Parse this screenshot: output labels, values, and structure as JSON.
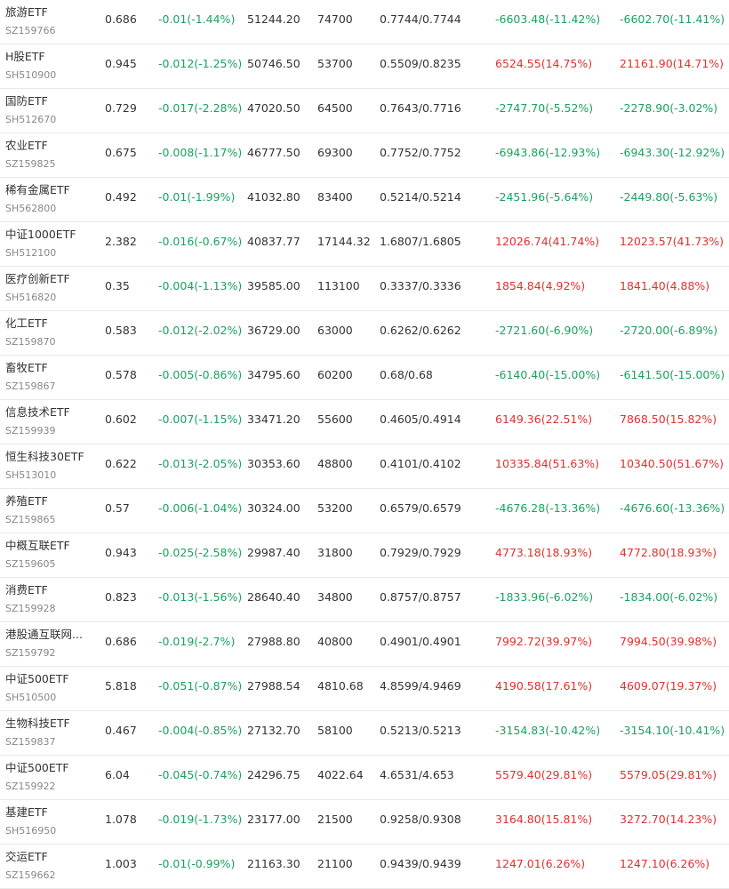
{
  "colors": {
    "up": "#e0312c",
    "down": "#1aa260",
    "text": "#333333",
    "subtext": "#888888"
  },
  "rows": [
    {
      "name": "旅游ETF",
      "code": "SZ159766",
      "price": "0.686",
      "change": "-0.01(-1.44%)",
      "value": "51244.20",
      "shares": "74700",
      "cost": "0.7744/0.7744",
      "pl1": "-6603.48(-11.42%)",
      "pl2": "-6602.70(-11.41%)",
      "pl1_dir": "down",
      "pl2_dir": "down"
    },
    {
      "name": "H股ETF",
      "code": "SH510900",
      "price": "0.945",
      "change": "-0.012(-1.25%)",
      "value": "50746.50",
      "shares": "53700",
      "cost": "0.5509/0.8235",
      "pl1": "6524.55(14.75%)",
      "pl2": "21161.90(14.71%)",
      "pl1_dir": "up",
      "pl2_dir": "up"
    },
    {
      "name": "国防ETF",
      "code": "SH512670",
      "price": "0.729",
      "change": "-0.017(-2.28%)",
      "value": "47020.50",
      "shares": "64500",
      "cost": "0.7643/0.7716",
      "pl1": "-2747.70(-5.52%)",
      "pl2": "-2278.90(-3.02%)",
      "pl1_dir": "down",
      "pl2_dir": "down"
    },
    {
      "name": "农业ETF",
      "code": "SZ159825",
      "price": "0.675",
      "change": "-0.008(-1.17%)",
      "value": "46777.50",
      "shares": "69300",
      "cost": "0.7752/0.7752",
      "pl1": "-6943.86(-12.93%)",
      "pl2": "-6943.30(-12.92%)",
      "pl1_dir": "down",
      "pl2_dir": "down"
    },
    {
      "name": "稀有金属ETF",
      "code": "SH562800",
      "price": "0.492",
      "change": "-0.01(-1.99%)",
      "value": "41032.80",
      "shares": "83400",
      "cost": "0.5214/0.5214",
      "pl1": "-2451.96(-5.64%)",
      "pl2": "-2449.80(-5.63%)",
      "pl1_dir": "down",
      "pl2_dir": "down"
    },
    {
      "name": "中证1000ETF",
      "code": "SH512100",
      "price": "2.382",
      "change": "-0.016(-0.67%)",
      "value": "40837.77",
      "shares": "17144.32",
      "cost": "1.6807/1.6805",
      "pl1": "12026.74(41.74%)",
      "pl2": "12023.57(41.73%)",
      "pl1_dir": "up",
      "pl2_dir": "up"
    },
    {
      "name": "医疗创新ETF",
      "code": "SH516820",
      "price": "0.35",
      "change": "-0.004(-1.13%)",
      "value": "39585.00",
      "shares": "113100",
      "cost": "0.3337/0.3336",
      "pl1": "1854.84(4.92%)",
      "pl2": "1841.40(4.88%)",
      "pl1_dir": "up",
      "pl2_dir": "up"
    },
    {
      "name": "化工ETF",
      "code": "SZ159870",
      "price": "0.583",
      "change": "-0.012(-2.02%)",
      "value": "36729.00",
      "shares": "63000",
      "cost": "0.6262/0.6262",
      "pl1": "-2721.60(-6.90%)",
      "pl2": "-2720.00(-6.89%)",
      "pl1_dir": "down",
      "pl2_dir": "down"
    },
    {
      "name": "畜牧ETF",
      "code": "SZ159867",
      "price": "0.578",
      "change": "-0.005(-0.86%)",
      "value": "34795.60",
      "shares": "60200",
      "cost": "0.68/0.68",
      "pl1": "-6140.40(-15.00%)",
      "pl2": "-6141.50(-15.00%)",
      "pl1_dir": "down",
      "pl2_dir": "down"
    },
    {
      "name": "信息技术ETF",
      "code": "SZ159939",
      "price": "0.602",
      "change": "-0.007(-1.15%)",
      "value": "33471.20",
      "shares": "55600",
      "cost": "0.4605/0.4914",
      "pl1": "6149.36(22.51%)",
      "pl2": "7868.50(15.82%)",
      "pl1_dir": "up",
      "pl2_dir": "up"
    },
    {
      "name": "恒生科技30ETF",
      "code": "SH513010",
      "price": "0.622",
      "change": "-0.013(-2.05%)",
      "value": "30353.60",
      "shares": "48800",
      "cost": "0.4101/0.4102",
      "pl1": "10335.84(51.63%)",
      "pl2": "10340.50(51.67%)",
      "pl1_dir": "up",
      "pl2_dir": "up"
    },
    {
      "name": "养殖ETF",
      "code": "SZ159865",
      "price": "0.57",
      "change": "-0.006(-1.04%)",
      "value": "30324.00",
      "shares": "53200",
      "cost": "0.6579/0.6579",
      "pl1": "-4676.28(-13.36%)",
      "pl2": "-4676.60(-13.36%)",
      "pl1_dir": "down",
      "pl2_dir": "down"
    },
    {
      "name": "中概互联ETF",
      "code": "SZ159605",
      "price": "0.943",
      "change": "-0.025(-2.58%)",
      "value": "29987.40",
      "shares": "31800",
      "cost": "0.7929/0.7929",
      "pl1": "4773.18(18.93%)",
      "pl2": "4772.80(18.93%)",
      "pl1_dir": "up",
      "pl2_dir": "up"
    },
    {
      "name": "消费ETF",
      "code": "SZ159928",
      "price": "0.823",
      "change": "-0.013(-1.56%)",
      "value": "28640.40",
      "shares": "34800",
      "cost": "0.8757/0.8757",
      "pl1": "-1833.96(-6.02%)",
      "pl2": "-1834.00(-6.02%)",
      "pl1_dir": "down",
      "pl2_dir": "down"
    },
    {
      "name": "港股通互联网...",
      "code": "SZ159792",
      "price": "0.686",
      "change": "-0.019(-2.7%)",
      "value": "27988.80",
      "shares": "40800",
      "cost": "0.4901/0.4901",
      "pl1": "7992.72(39.97%)",
      "pl2": "7994.50(39.98%)",
      "pl1_dir": "up",
      "pl2_dir": "up"
    },
    {
      "name": "中证500ETF",
      "code": "SH510500",
      "price": "5.818",
      "change": "-0.051(-0.87%)",
      "value": "27988.54",
      "shares": "4810.68",
      "cost": "4.8599/4.9469",
      "pl1": "4190.58(17.61%)",
      "pl2": "4609.07(19.37%)",
      "pl1_dir": "up",
      "pl2_dir": "up"
    },
    {
      "name": "生物科技ETF",
      "code": "SZ159837",
      "price": "0.467",
      "change": "-0.004(-0.85%)",
      "value": "27132.70",
      "shares": "58100",
      "cost": "0.5213/0.5213",
      "pl1": "-3154.83(-10.42%)",
      "pl2": "-3154.10(-10.41%)",
      "pl1_dir": "down",
      "pl2_dir": "down"
    },
    {
      "name": "中证500ETF",
      "code": "SZ159922",
      "price": "6.04",
      "change": "-0.045(-0.74%)",
      "value": "24296.75",
      "shares": "4022.64",
      "cost": "4.6531/4.653",
      "pl1": "5579.40(29.81%)",
      "pl2": "5579.05(29.81%)",
      "pl1_dir": "up",
      "pl2_dir": "up"
    },
    {
      "name": "基建ETF",
      "code": "SH516950",
      "price": "1.078",
      "change": "-0.019(-1.73%)",
      "value": "23177.00",
      "shares": "21500",
      "cost": "0.9258/0.9308",
      "pl1": "3164.80(15.81%)",
      "pl2": "3272.70(14.23%)",
      "pl1_dir": "up",
      "pl2_dir": "up"
    },
    {
      "name": "交运ETF",
      "code": "SZ159662",
      "price": "1.003",
      "change": "-0.01(-0.99%)",
      "value": "21163.30",
      "shares": "21100",
      "cost": "0.9439/0.9439",
      "pl1": "1247.01(6.26%)",
      "pl2": "1247.10(6.26%)",
      "pl1_dir": "up",
      "pl2_dir": "up"
    }
  ]
}
